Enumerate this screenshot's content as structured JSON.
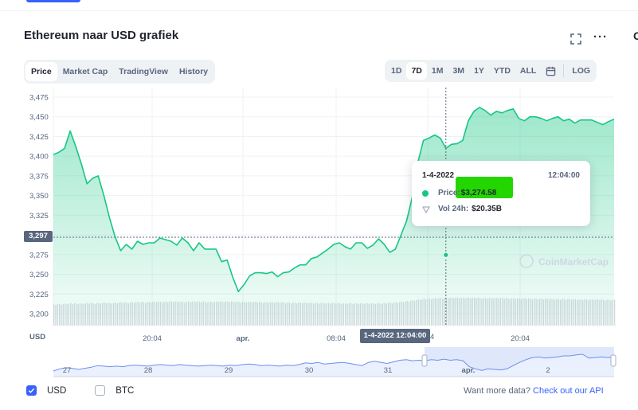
{
  "header": {
    "title": "Ethereum naar USD grafiek",
    "more_label": "···"
  },
  "tabs": [
    {
      "label": "Price",
      "active": true
    },
    {
      "label": "Market Cap",
      "active": false
    },
    {
      "label": "TradingView",
      "active": false
    },
    {
      "label": "History",
      "active": false
    }
  ],
  "ranges": [
    {
      "label": "1D",
      "active": false
    },
    {
      "label": "7D",
      "active": true
    },
    {
      "label": "1M",
      "active": false
    },
    {
      "label": "3M",
      "active": false
    },
    {
      "label": "1Y",
      "active": false
    },
    {
      "label": "YTD",
      "active": false
    },
    {
      "label": "ALL",
      "active": false
    }
  ],
  "log_label": "LOG",
  "current_price_label": "3,297",
  "hover_date": "1-4-2022 12:04:00",
  "hover_date_overflow": "4",
  "tooltip": {
    "date": "1-4-2022",
    "time": "12:04:00",
    "price_label": "Price:",
    "price_value": "$3,274.58",
    "vol_label": "Vol 24h:",
    "vol_value": "$20.35B"
  },
  "watermark": "CoinMarketCap",
  "legend": {
    "usd_label": "USD",
    "usd_checked": true,
    "btc_label": "BTC",
    "btc_checked": false
  },
  "api": {
    "prefix": "Want more data?",
    "link": "Check out our API"
  },
  "colors": {
    "line": "#16c784",
    "accent": "#3861fb",
    "highlight": "#23d600"
  },
  "chart_data": {
    "type": "area",
    "currency_label": "USD",
    "y_ticks": [
      "3,475",
      "3,450",
      "3,425",
      "3,400",
      "3,375",
      "3,350",
      "3,325",
      "3,300",
      "3,275",
      "3,250",
      "3,225",
      "3,200"
    ],
    "ylim": [
      3190,
      3482
    ],
    "current_price": 3297,
    "x_ticks": [
      "20:04",
      "apr.",
      "08:04",
      "20:04"
    ],
    "navigator_labels": [
      "27",
      "28",
      "29",
      "30",
      "31",
      "apr.",
      "2"
    ],
    "hover": {
      "x": 70,
      "y": 3274.58
    },
    "series": [
      {
        "x": [
          0,
          1,
          2,
          3,
          4,
          5,
          6,
          7,
          8,
          9,
          10,
          11,
          12,
          13,
          14,
          15,
          16,
          17,
          18,
          19,
          20,
          21,
          22,
          23,
          24,
          25,
          26,
          27,
          28,
          29,
          30,
          31,
          32,
          33,
          34,
          35,
          36,
          37,
          38,
          39,
          40,
          41,
          42,
          43,
          44,
          45,
          46,
          47,
          48,
          49,
          50,
          51,
          52,
          53,
          54,
          55,
          56,
          57,
          58,
          59,
          60,
          61,
          62,
          63,
          64,
          65,
          66,
          67,
          68,
          69,
          70,
          71,
          72,
          73,
          74,
          75,
          76,
          77,
          78,
          79,
          80,
          81,
          82,
          83,
          84,
          85,
          86,
          87,
          88,
          89,
          90,
          91,
          92,
          93,
          94,
          95,
          96,
          97,
          98,
          99,
          100
        ],
        "values": [
          3402,
          3405,
          3410,
          3432,
          3412,
          3390,
          3365,
          3372,
          3375,
          3350,
          3322,
          3298,
          3280,
          3288,
          3282,
          3292,
          3288,
          3290,
          3290,
          3296,
          3294,
          3292,
          3287,
          3296,
          3290,
          3280,
          3290,
          3282,
          3282,
          3282,
          3266,
          3268,
          3246,
          3228,
          3237,
          3248,
          3252,
          3252,
          3251,
          3253,
          3247,
          3252,
          3253,
          3258,
          3262,
          3262,
          3270,
          3272,
          3277,
          3282,
          3288,
          3290,
          3285,
          3282,
          3290,
          3290,
          3283,
          3287,
          3295,
          3288,
          3278,
          3282,
          3300,
          3318,
          3348,
          3392,
          3420,
          3423,
          3427,
          3423,
          3410,
          3415,
          3416,
          3420,
          3445,
          3457,
          3462,
          3458,
          3452,
          3457,
          3455,
          3458,
          3460,
          3448,
          3445,
          3450,
          3450,
          3448,
          3445,
          3448,
          3450,
          3445,
          3447,
          3442,
          3446,
          3446,
          3446,
          3443,
          3440,
          3444,
          3447
        ],
        "volume": [
          0.6,
          0.61,
          0.62,
          0.63,
          0.62,
          0.63,
          0.64,
          0.63,
          0.64,
          0.65,
          0.64,
          0.65,
          0.66,
          0.65,
          0.66,
          0.67,
          0.66,
          0.67,
          0.68,
          0.67,
          0.68,
          0.68,
          0.68,
          0.67,
          0.68,
          0.68,
          0.68,
          0.67,
          0.67,
          0.68,
          0.68,
          0.68,
          0.68,
          0.67,
          0.67,
          0.67,
          0.67,
          0.66,
          0.66,
          0.66,
          0.66,
          0.65,
          0.65,
          0.65,
          0.65,
          0.65,
          0.64,
          0.64,
          0.64,
          0.64,
          0.64,
          0.63,
          0.63,
          0.63,
          0.63,
          0.63,
          0.63,
          0.63,
          0.63,
          0.64,
          0.65,
          0.66,
          0.68,
          0.7,
          0.72,
          0.74,
          0.76,
          0.77,
          0.78,
          0.78,
          0.79,
          0.79,
          0.79,
          0.79,
          0.79,
          0.79,
          0.78,
          0.78,
          0.78,
          0.78,
          0.78,
          0.77,
          0.77,
          0.77,
          0.77,
          0.76,
          0.76,
          0.76,
          0.76,
          0.75,
          0.75,
          0.75,
          0.75,
          0.74,
          0.74,
          0.74,
          0.74,
          0.74,
          0.73,
          0.73,
          0.73
        ]
      }
    ],
    "navigator": [
      3230,
      3238,
      3242,
      3240,
      3236,
      3240,
      3244,
      3250,
      3248,
      3246,
      3248,
      3246,
      3250,
      3252,
      3250,
      3248,
      3252,
      3254,
      3252,
      3250,
      3254,
      3252,
      3250,
      3248,
      3250,
      3252,
      3250,
      3248,
      3252,
      3250,
      3254,
      3256,
      3254,
      3250,
      3252,
      3250,
      3248,
      3252,
      3250,
      3254,
      3260,
      3258,
      3262,
      3256,
      3258,
      3260,
      3262,
      3258,
      3254,
      3250,
      3262,
      3266,
      3262,
      3258,
      3264,
      3270,
      3272,
      3268,
      3270,
      3268,
      3272,
      3270,
      3274,
      3270,
      3272,
      3268,
      3246,
      3238,
      3232,
      3238,
      3236,
      3234,
      3238,
      3250,
      3262,
      3272,
      3280,
      3282,
      3278,
      3280,
      3282,
      3286,
      3286,
      3290,
      3292,
      3278,
      3280,
      3282,
      3280,
      3282
    ]
  }
}
